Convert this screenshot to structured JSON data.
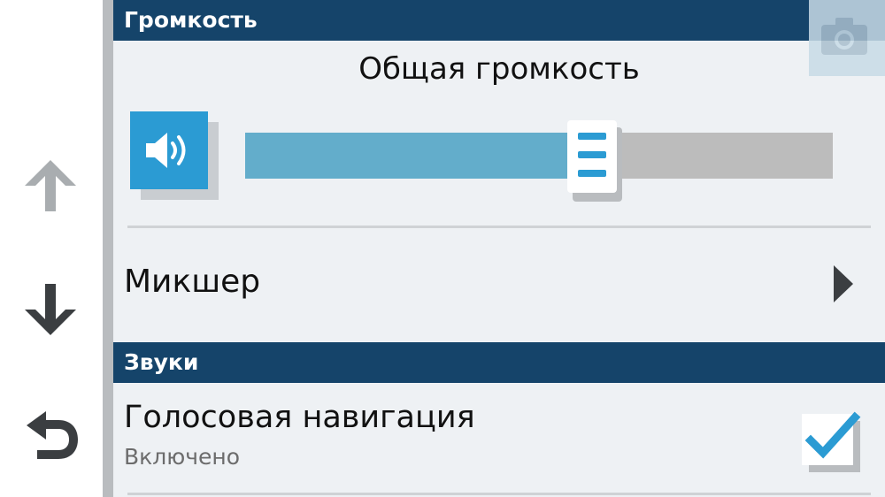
{
  "nav": {
    "up_icon": "arrow-up-icon",
    "down_icon": "arrow-down-icon",
    "back_icon": "back-arrow-icon"
  },
  "volume_section": {
    "header": "Громкость",
    "camera_icon": "camera-icon",
    "master_volume_title": "Общая громкость",
    "speaker_icon": "speaker-icon",
    "slider_level_fraction": 0.6
  },
  "mixer": {
    "label": "Микшер",
    "chevron_icon": "chevron-right-icon"
  },
  "sounds_section": {
    "header": "Звуки",
    "voice_navigation": {
      "title": "Голосовая навигация",
      "status": "Включено",
      "checked": true
    }
  },
  "colors": {
    "header_bg": "#15446a",
    "accent_blue": "#2b9bd3",
    "slider_fill": "#63adcb",
    "slider_track": "#bcbcbc",
    "background": "#eef1f4"
  }
}
